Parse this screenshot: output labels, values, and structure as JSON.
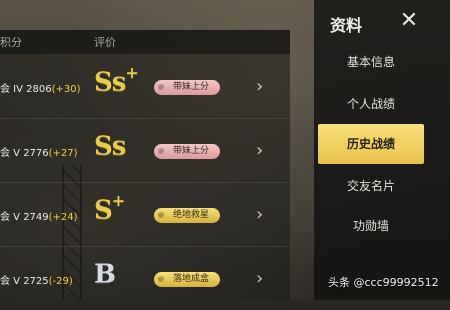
{
  "header": {
    "col_score": "积分",
    "col_eval": "评价"
  },
  "rows": [
    {
      "score_text": "会 IV 2806",
      "change": "(+30)",
      "rank_main": "Ss",
      "rank_sup": "+",
      "tag": "带妹上分",
      "tag_style": "pink"
    },
    {
      "score_text": "会 V 2776",
      "change": "(+27)",
      "rank_main": "Ss",
      "rank_sup": "",
      "tag": "带妹上分",
      "tag_style": "pink"
    },
    {
      "score_text": "会 V 2749",
      "change": "(+24)",
      "rank_main": "S",
      "rank_sup": "+",
      "tag": "绝地救星",
      "tag_style": "gold"
    },
    {
      "score_text": "会 V 2725",
      "change": "(-29)",
      "rank_main": "B",
      "rank_sup": "",
      "tag": "落地成盒",
      "tag_style": "gold"
    }
  ],
  "sidebar": {
    "title": "资料",
    "items": [
      "基本信息",
      "个人战绩",
      "历史战绩",
      "交友名片",
      "功勋墙"
    ],
    "active_index": 2
  },
  "watermark": "头条 @ccc99992512",
  "icons": {
    "close": "close-icon",
    "chevron": "chevron-right-icon"
  },
  "colors": {
    "accent": "#f2cf44",
    "active_tab": "#f0cf5e",
    "tag_pink": "#e8b4b4",
    "tag_gold": "#e9cc58"
  }
}
